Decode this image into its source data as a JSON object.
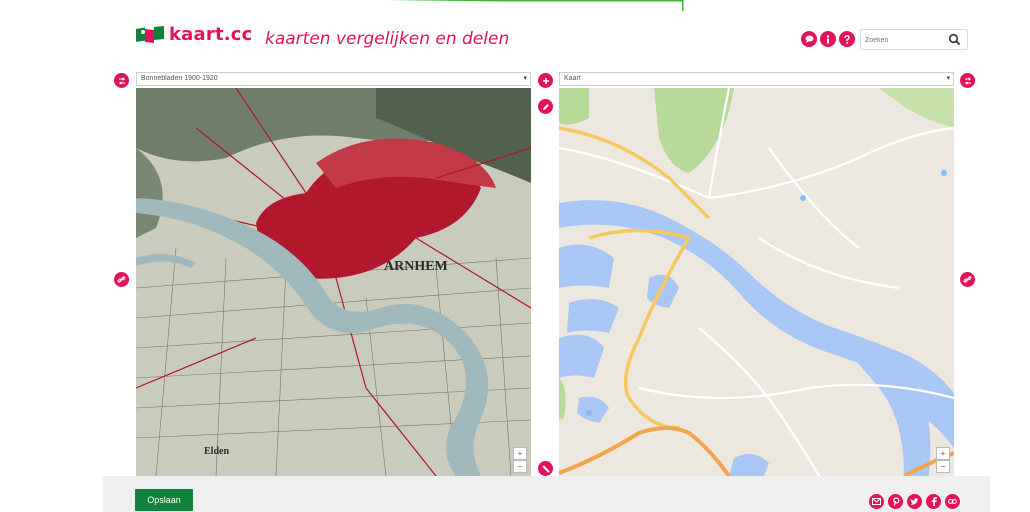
{
  "header": {
    "logo_text": "kaart.cc",
    "tagline": "kaarten vergelijken en delen",
    "icons": [
      "chat-icon",
      "info-icon",
      "help-icon"
    ],
    "search_placeholder": "Zoeken"
  },
  "left_panel": {
    "selected_map": "Bonnebladen 1900-1920",
    "map_label": "ARNHEM",
    "place_label": "Elden",
    "zoom_in": "+",
    "zoom_out": "−"
  },
  "right_panel": {
    "selected_map": "Kaart",
    "zoom_in": "+",
    "zoom_out": "−"
  },
  "footer": {
    "save_label": "Opslaan",
    "share_icons": [
      "email-icon",
      "pinterest-icon",
      "twitter-icon",
      "facebook-icon",
      "link-icon"
    ]
  },
  "colors": {
    "accent": "#e2135a",
    "brand_green": "#11823b",
    "top_bar": "#3db339"
  }
}
